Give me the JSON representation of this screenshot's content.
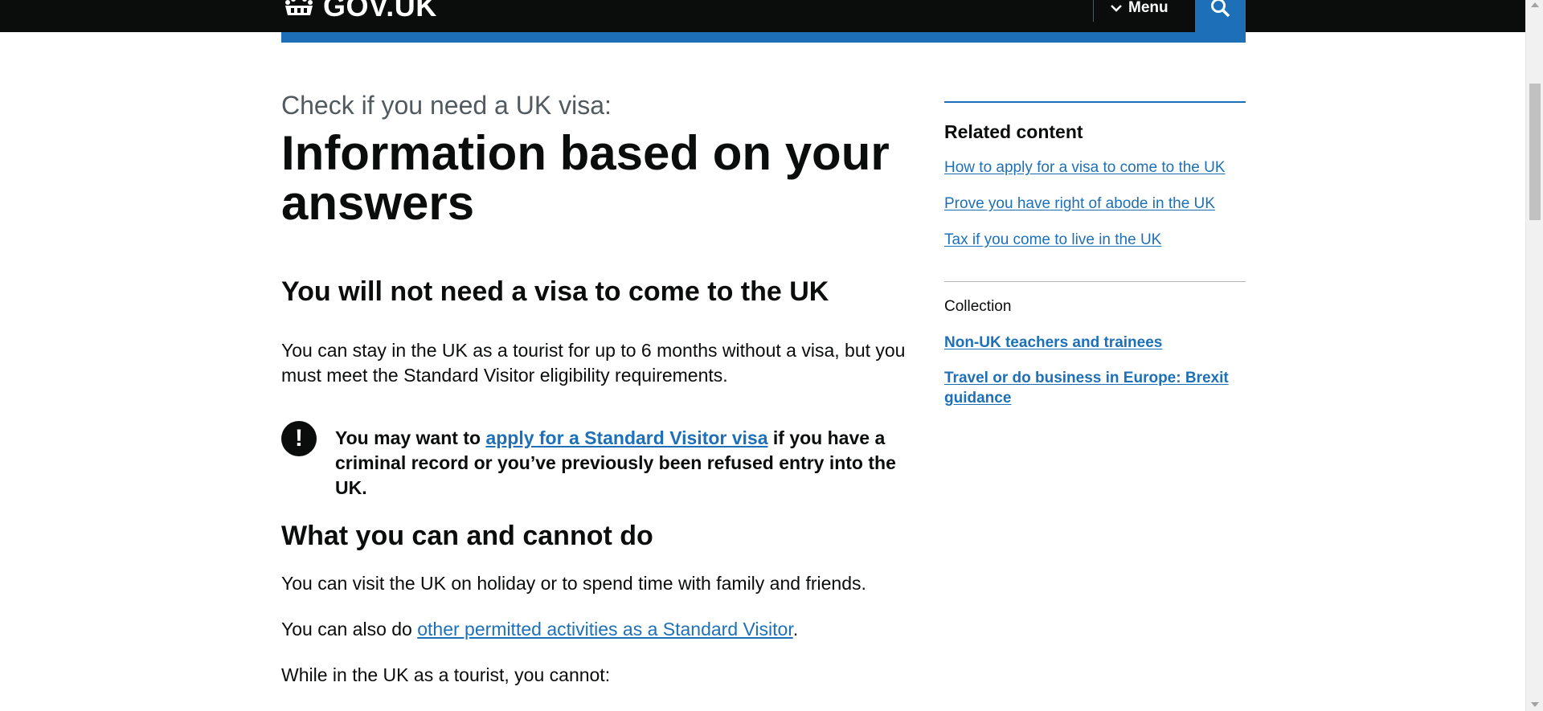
{
  "header": {
    "logo_text": "GOV.UK",
    "menu_label": "Menu",
    "search_icon": "search-icon",
    "crown_icon": "crown-icon"
  },
  "colors": {
    "header_bg": "#0b0c0c",
    "brand_blue": "#1d70b8",
    "text": "#0b0c0c",
    "secondary_text": "#505a5f"
  },
  "main": {
    "caption": "Check if you need a UK visa:",
    "title": "Information based on your answers",
    "heading_1": "You will not need a visa to come to the UK",
    "paragraph_1": "You can stay in the UK as a tourist for up to 6 months without a visa, but you must meet the Standard Visitor eligibility requirements.",
    "warning": {
      "icon": "!",
      "text_before": "You may want to ",
      "link_text": "apply for a Standard Visitor visa",
      "text_after": " if you have a criminal record or you’ve previously been refused entry into the UK."
    },
    "heading_2": "What you can and cannot do",
    "paragraph_2": "You can visit the UK on holiday or to spend time with family and friends.",
    "paragraph_3_before": "You can also do ",
    "paragraph_3_link": "other permitted activities as a Standard Visitor",
    "paragraph_3_after": ".",
    "paragraph_4": "While in the UK as a tourist, you cannot:"
  },
  "sidebar": {
    "related_heading": "Related content",
    "related_links": [
      "How to apply for a visa to come to the UK",
      "Prove you have right of abode in the UK",
      "Tax if you come to live in the UK"
    ],
    "collection_label": "Collection",
    "collection_links": [
      "Non-UK teachers and trainees",
      "Travel or do business in Europe: Brexit guidance"
    ]
  }
}
